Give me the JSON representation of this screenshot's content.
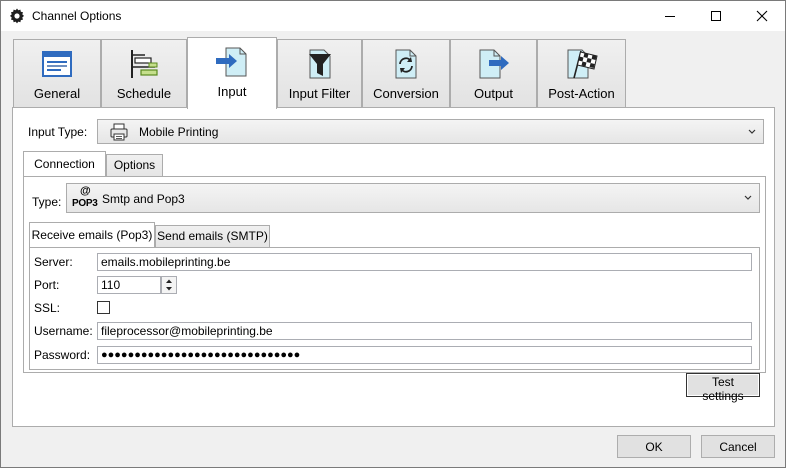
{
  "window": {
    "title": "Channel Options",
    "icon": "gear-icon"
  },
  "main_tabs": [
    {
      "label": "General",
      "icon": "window-icon"
    },
    {
      "label": "Schedule",
      "icon": "schedule-timeline-icon"
    },
    {
      "label": "Input",
      "icon": "document-arrow-in-icon",
      "active": true
    },
    {
      "label": "Input Filter",
      "icon": "filter-icon"
    },
    {
      "label": "Conversion",
      "icon": "convert-document-icon"
    },
    {
      "label": "Output",
      "icon": "document-arrow-out-icon"
    },
    {
      "label": "Post-Action",
      "icon": "checkered-flag-icon"
    }
  ],
  "input_type": {
    "label": "Input Type:",
    "value": "Mobile Printing",
    "icon": "printer-icon"
  },
  "sub_tabs": [
    {
      "label": "Connection",
      "active": true
    },
    {
      "label": "Options"
    }
  ],
  "connection": {
    "type_label": "Type:",
    "type_value": "Smtp and Pop3",
    "type_icon_text_top": "@",
    "type_icon_text_bottom": "POP3"
  },
  "mail_tabs": [
    {
      "label": "Receive emails (Pop3)",
      "active": true
    },
    {
      "label": "Send emails (SMTP)"
    }
  ],
  "pop3": {
    "server_label": "Server:",
    "server_value": "emails.mobileprinting.be",
    "port_label": "Port:",
    "port_value": "110",
    "ssl_label": "SSL:",
    "ssl_checked": false,
    "username_label": "Username:",
    "username_value": "fileprocessor@mobileprinting.be",
    "password_label": "Password:",
    "password_value": "●●●●●●●●●●●●●●●●●●●●●●●●●●●●●●"
  },
  "buttons": {
    "test_settings": "Test settings",
    "ok": "OK",
    "cancel": "Cancel"
  },
  "colors": {
    "accent_blue": "#2f6bbf",
    "icon_teal": "#cfeef6"
  }
}
